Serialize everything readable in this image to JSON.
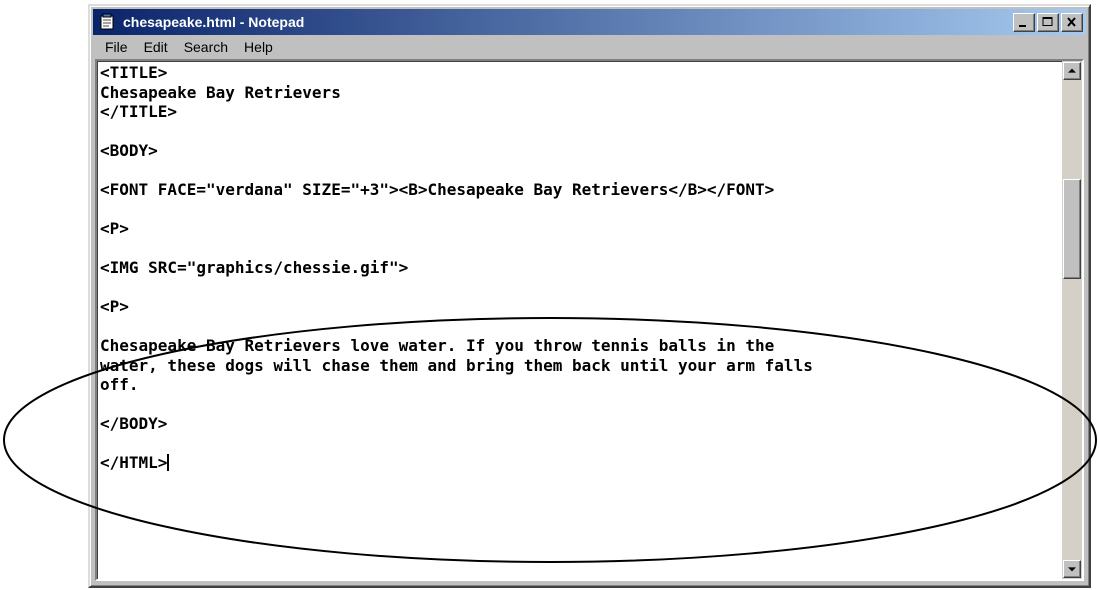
{
  "window": {
    "title": "chesapeake.html - Notepad",
    "controls": [
      "minimize",
      "maximize",
      "close"
    ]
  },
  "menu": {
    "items": [
      {
        "label": "File"
      },
      {
        "label": "Edit"
      },
      {
        "label": "Search"
      },
      {
        "label": "Help"
      }
    ]
  },
  "editor": {
    "lines": [
      "<TITLE>",
      "Chesapeake Bay Retrievers",
      "</TITLE>",
      "",
      "<BODY>",
      "",
      "<FONT FACE=\"verdana\" SIZE=\"+3\"><B>Chesapeake Bay Retrievers</B></FONT>",
      "",
      "<P>",
      "",
      "<IMG SRC=\"graphics/chessie.gif\">",
      "",
      "<P>",
      "",
      "Chesapeake Bay Retrievers love water. If you throw tennis balls in the",
      "water, these dogs will chase them and bring them back until your arm falls",
      "off.",
      "",
      "</BODY>",
      "",
      "</HTML>"
    ]
  },
  "icons": {
    "app": "notepad-icon",
    "scroll_up": "arrow-up-icon",
    "scroll_down": "arrow-down-icon"
  },
  "colors": {
    "titlebar_start": "#0a246a",
    "titlebar_end": "#a6caf0",
    "chrome": "#c0c0c0"
  }
}
